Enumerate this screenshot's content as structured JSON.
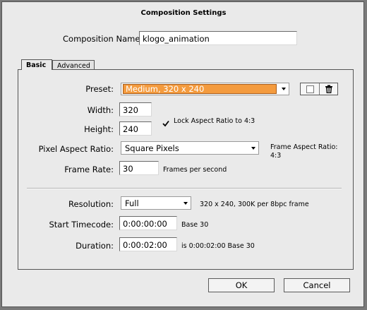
{
  "dialog": {
    "title": "Composition Settings"
  },
  "comp_name": {
    "label": "Composition Name:",
    "value": "klogo_animation"
  },
  "tabs": [
    {
      "label": "Basic"
    },
    {
      "label": "Advanced"
    }
  ],
  "basic": {
    "preset": {
      "label": "Preset:",
      "value": "Medium, 320 x 240"
    },
    "width": {
      "label": "Width:",
      "value": "320"
    },
    "height": {
      "label": "Height:",
      "value": "240"
    },
    "lock_aspect": {
      "label": "Lock Aspect Ratio to 4:3",
      "checked": true
    },
    "pixel_aspect": {
      "label": "Pixel Aspect Ratio:",
      "value": "Square Pixels"
    },
    "frame_aspect": {
      "label": "Frame Aspect Ratio:",
      "value": "4:3"
    },
    "frame_rate": {
      "label": "Frame Rate:",
      "value": "30",
      "unit": "Frames per second"
    },
    "resolution": {
      "label": "Resolution:",
      "value": "Full",
      "info": "320 x 240, 300K per 8bpc frame"
    },
    "start_timecode": {
      "label": "Start Timecode:",
      "value": "0:00:00:00",
      "base": "Base 30"
    },
    "duration": {
      "label": "Duration:",
      "value": "0:00:02:00",
      "info": "is 0:00:02:00  Base 30"
    }
  },
  "buttons": {
    "ok": "OK",
    "cancel": "Cancel"
  },
  "icons": {
    "new_preset": "new-preset-icon",
    "delete_preset": "trash-icon"
  }
}
